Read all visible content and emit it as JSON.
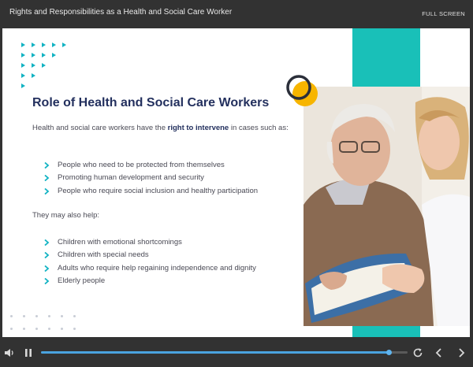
{
  "player": {
    "title": "Rights and Responsibilities as a Health and Social Care Worker",
    "fullscreen_label": "FULL SCREEN",
    "progress": 0.948
  },
  "slide": {
    "heading": "Role of Health and Social Care Workers",
    "intro_prefix": "Health and social care workers have the ",
    "intro_bold": "right to intervene",
    "intro_suffix": " in cases such as:",
    "list1": [
      "People who need to be protected from themselves",
      "Promoting human development and security",
      "People who require social inclusion and healthy participation"
    ],
    "also_help": "They may also help:",
    "list2": [
      "Children with emotional shortcomings",
      "Children with special needs",
      "Adults who require help regaining independence and dignity",
      "Elderly people"
    ]
  },
  "colors": {
    "accent_teal": "#19c0b8",
    "heading_navy": "#23305e",
    "deco_yellow": "#f7b500",
    "progress_blue": "#4aa3df"
  },
  "icons": [
    "volume-icon",
    "pause-icon",
    "replay-icon",
    "previous-icon",
    "next-icon"
  ]
}
